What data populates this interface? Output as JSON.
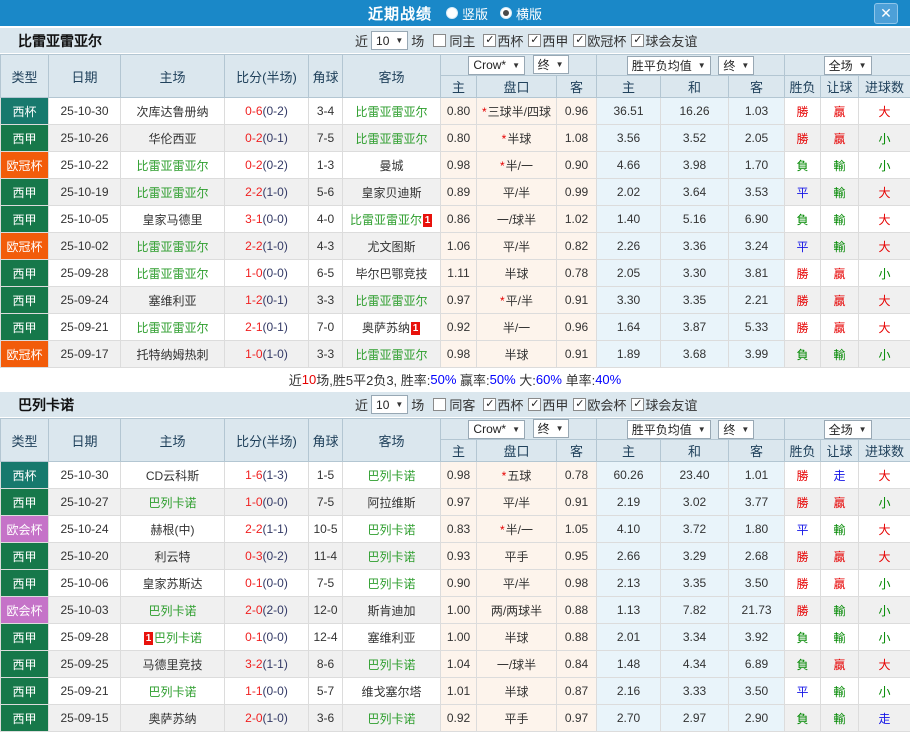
{
  "titlebar": {
    "title": "近期战绩",
    "radio_vertical": "竖版",
    "radio_horizontal": "横版"
  },
  "ui": {
    "check": "✓",
    "arrow": "▼",
    "close": "✕"
  },
  "colors": {
    "topbar": "#1a88c8",
    "header_bg": "#dbe7ee",
    "team_highlight": "#2e9e2e",
    "score_red": "#f02020",
    "type_badge": {
      "西杯": "#17796d",
      "西甲": "#16784a",
      "欧冠杯": "#f25c0a",
      "欧会杯": "#c573c8"
    },
    "result": {
      "勝": "#e60000",
      "贏": "#e60000",
      "大": "#e60000",
      "負": "#008800",
      "輸": "#008800",
      "小": "#008800",
      "平": "#1414e6",
      "走": "#1414e6"
    }
  },
  "table_columns": {
    "type": "类型",
    "date": "日期",
    "home": "主场",
    "score": "比分(半场)",
    "corner": "角球",
    "away": "客场",
    "odds_home": "主",
    "odds_handicap": "盘口",
    "odds_away": "客",
    "avg_home": "主",
    "avg_draw": "和",
    "avg_away": "客",
    "result_wdl": "胜负",
    "result_handicap": "让球",
    "result_goals": "进球数",
    "odds_select": "Crow*",
    "odds_final_select": "终",
    "avg_select": "胜平负均值",
    "avg_final_select": "终",
    "scope_select": "全场"
  },
  "sections": [
    {
      "team": "比雷亚雷亚尔",
      "filter": {
        "near": "近",
        "games": "10",
        "unit": "场",
        "same": "同主",
        "same_checked": false,
        "leagues": [
          {
            "label": "西杯",
            "checked": true
          },
          {
            "label": "西甲",
            "checked": true
          },
          {
            "label": "欧冠杯",
            "checked": true
          },
          {
            "label": "球会友谊",
            "checked": true
          }
        ]
      },
      "rows": [
        {
          "type": "西杯",
          "date": "25-10-30",
          "home": {
            "name": "次库达鲁册纳",
            "green": false
          },
          "score": "0-6",
          "half": "(0-2)",
          "corner": "3-4",
          "away": {
            "name": "比雷亚雷亚尔",
            "green": true
          },
          "odds_home": "0.80",
          "handicap_star": true,
          "handicap": "三球半/四球",
          "odds_away": "0.96",
          "avg_home": "36.51",
          "avg_draw": "16.26",
          "avg_away": "1.03",
          "res_wdl": "勝",
          "res_handicap": "贏",
          "res_goals": "大"
        },
        {
          "type": "西甲",
          "date": "25-10-26",
          "home": {
            "name": "华伦西亚",
            "green": false
          },
          "score": "0-2",
          "half": "(0-1)",
          "corner": "7-5",
          "away": {
            "name": "比雷亚雷亚尔",
            "green": true
          },
          "odds_home": "0.80",
          "handicap_star": true,
          "handicap": "半球",
          "odds_away": "1.08",
          "avg_home": "3.56",
          "avg_draw": "3.52",
          "avg_away": "2.05",
          "res_wdl": "勝",
          "res_handicap": "贏",
          "res_goals": "小"
        },
        {
          "type": "欧冠杯",
          "date": "25-10-22",
          "home": {
            "name": "比雷亚雷亚尔",
            "green": true
          },
          "score": "0-2",
          "half": "(0-2)",
          "corner": "1-3",
          "away": {
            "name": "曼城",
            "green": false
          },
          "odds_home": "0.98",
          "handicap_star": true,
          "handicap": "半/一",
          "odds_away": "0.90",
          "avg_home": "4.66",
          "avg_draw": "3.98",
          "avg_away": "1.70",
          "res_wdl": "負",
          "res_handicap": "輸",
          "res_goals": "小"
        },
        {
          "type": "西甲",
          "date": "25-10-19",
          "home": {
            "name": "比雷亚雷亚尔",
            "green": true
          },
          "score": "2-2",
          "half": "(1-0)",
          "corner": "5-6",
          "away": {
            "name": "皇家贝迪斯",
            "green": false
          },
          "odds_home": "0.89",
          "handicap_star": false,
          "handicap": "平/半",
          "odds_away": "0.99",
          "avg_home": "2.02",
          "avg_draw": "3.64",
          "avg_away": "3.53",
          "res_wdl": "平",
          "res_handicap": "輸",
          "res_goals": "大"
        },
        {
          "type": "西甲",
          "date": "25-10-05",
          "home": {
            "name": "皇家马德里",
            "green": false
          },
          "score": "3-1",
          "half": "(0-0)",
          "corner": "4-0",
          "away": {
            "name": "比雷亚雷亚尔",
            "green": true,
            "badge": "1",
            "badge_pos": "after"
          },
          "odds_home": "0.86",
          "handicap_star": false,
          "handicap": "一/球半",
          "odds_away": "1.02",
          "avg_home": "1.40",
          "avg_draw": "5.16",
          "avg_away": "6.90",
          "res_wdl": "負",
          "res_handicap": "輸",
          "res_goals": "大"
        },
        {
          "type": "欧冠杯",
          "date": "25-10-02",
          "home": {
            "name": "比雷亚雷亚尔",
            "green": true
          },
          "score": "2-2",
          "half": "(1-0)",
          "corner": "4-3",
          "away": {
            "name": "尤文图斯",
            "green": false
          },
          "odds_home": "1.06",
          "handicap_star": false,
          "handicap": "平/半",
          "odds_away": "0.82",
          "avg_home": "2.26",
          "avg_draw": "3.36",
          "avg_away": "3.24",
          "res_wdl": "平",
          "res_handicap": "輸",
          "res_goals": "大"
        },
        {
          "type": "西甲",
          "date": "25-09-28",
          "home": {
            "name": "比雷亚雷亚尔",
            "green": true
          },
          "score": "1-0",
          "half": "(0-0)",
          "corner": "6-5",
          "away": {
            "name": "毕尔巴鄂竞技",
            "green": false
          },
          "odds_home": "1.11",
          "handicap_star": false,
          "handicap": "半球",
          "odds_away": "0.78",
          "avg_home": "2.05",
          "avg_draw": "3.30",
          "avg_away": "3.81",
          "res_wdl": "勝",
          "res_handicap": "贏",
          "res_goals": "小"
        },
        {
          "type": "西甲",
          "date": "25-09-24",
          "home": {
            "name": "塞维利亚",
            "green": false
          },
          "score": "1-2",
          "half": "(0-1)",
          "corner": "3-3",
          "away": {
            "name": "比雷亚雷亚尔",
            "green": true
          },
          "odds_home": "0.97",
          "handicap_star": true,
          "handicap": "平/半",
          "odds_away": "0.91",
          "avg_home": "3.30",
          "avg_draw": "3.35",
          "avg_away": "2.21",
          "res_wdl": "勝",
          "res_handicap": "贏",
          "res_goals": "大"
        },
        {
          "type": "西甲",
          "date": "25-09-21",
          "home": {
            "name": "比雷亚雷亚尔",
            "green": true
          },
          "score": "2-1",
          "half": "(0-1)",
          "corner": "7-0",
          "away": {
            "name": "奥萨苏纳",
            "green": false,
            "badge": "1",
            "badge_pos": "after"
          },
          "odds_home": "0.92",
          "handicap_star": false,
          "handicap": "半/一",
          "odds_away": "0.96",
          "avg_home": "1.64",
          "avg_draw": "3.87",
          "avg_away": "5.33",
          "res_wdl": "勝",
          "res_handicap": "贏",
          "res_goals": "大"
        },
        {
          "type": "欧冠杯",
          "date": "25-09-17",
          "home": {
            "name": "托特纳姆热刺",
            "green": false
          },
          "score": "1-0",
          "half": "(1-0)",
          "corner": "3-3",
          "away": {
            "name": "比雷亚雷亚尔",
            "green": true
          },
          "odds_home": "0.98",
          "handicap_star": false,
          "handicap": "半球",
          "odds_away": "0.91",
          "avg_home": "1.89",
          "avg_draw": "3.68",
          "avg_away": "3.99",
          "res_wdl": "負",
          "res_handicap": "輸",
          "res_goals": "小"
        }
      ],
      "summary": [
        {
          "text": "近",
          "color": "#333333"
        },
        {
          "text": "10",
          "color": "#e60000"
        },
        {
          "text": "场,胜5平2负3, 胜率:",
          "color": "#333333"
        },
        {
          "text": "50%",
          "color": "#0000ff"
        },
        {
          "text": " 赢率:",
          "color": "#333333"
        },
        {
          "text": "50%",
          "color": "#0000ff"
        },
        {
          "text": " 大:",
          "color": "#333333"
        },
        {
          "text": "60%",
          "color": "#0000ff"
        },
        {
          "text": " 单率:",
          "color": "#333333"
        },
        {
          "text": "40%",
          "color": "#0000ff"
        }
      ]
    },
    {
      "team": "巴列卡诺",
      "filter": {
        "near": "近",
        "games": "10",
        "unit": "场",
        "same": "同客",
        "same_checked": false,
        "leagues": [
          {
            "label": "西杯",
            "checked": true
          },
          {
            "label": "西甲",
            "checked": true
          },
          {
            "label": "欧会杯",
            "checked": true
          },
          {
            "label": "球会友谊",
            "checked": true
          }
        ]
      },
      "rows": [
        {
          "type": "西杯",
          "date": "25-10-30",
          "home": {
            "name": "CD云科斯",
            "green": false
          },
          "score": "1-6",
          "half": "(1-3)",
          "corner": "1-5",
          "away": {
            "name": "巴列卡诺",
            "green": true
          },
          "odds_home": "0.98",
          "handicap_star": true,
          "handicap": "五球",
          "odds_away": "0.78",
          "avg_home": "60.26",
          "avg_draw": "23.40",
          "avg_away": "1.01",
          "res_wdl": "勝",
          "res_handicap": "走",
          "res_goals": "大"
        },
        {
          "type": "西甲",
          "date": "25-10-27",
          "home": {
            "name": "巴列卡诺",
            "green": true
          },
          "score": "1-0",
          "half": "(0-0)",
          "corner": "7-5",
          "away": {
            "name": "阿拉维斯",
            "green": false
          },
          "odds_home": "0.97",
          "handicap_star": false,
          "handicap": "平/半",
          "odds_away": "0.91",
          "avg_home": "2.19",
          "avg_draw": "3.02",
          "avg_away": "3.77",
          "res_wdl": "勝",
          "res_handicap": "贏",
          "res_goals": "小"
        },
        {
          "type": "欧会杯",
          "date": "25-10-24",
          "home": {
            "name": "赫根(中)",
            "green": false
          },
          "score": "2-2",
          "half": "(1-1)",
          "corner": "10-5",
          "away": {
            "name": "巴列卡诺",
            "green": true
          },
          "odds_home": "0.83",
          "handicap_star": true,
          "handicap": "半/一",
          "odds_away": "1.05",
          "avg_home": "4.10",
          "avg_draw": "3.72",
          "avg_away": "1.80",
          "res_wdl": "平",
          "res_handicap": "輸",
          "res_goals": "大"
        },
        {
          "type": "西甲",
          "date": "25-10-20",
          "home": {
            "name": "利云特",
            "green": false
          },
          "score": "0-3",
          "half": "(0-2)",
          "corner": "11-4",
          "away": {
            "name": "巴列卡诺",
            "green": true
          },
          "odds_home": "0.93",
          "handicap_star": false,
          "handicap": "平手",
          "odds_away": "0.95",
          "avg_home": "2.66",
          "avg_draw": "3.29",
          "avg_away": "2.68",
          "res_wdl": "勝",
          "res_handicap": "贏",
          "res_goals": "大"
        },
        {
          "type": "西甲",
          "date": "25-10-06",
          "home": {
            "name": "皇家苏斯达",
            "green": false
          },
          "score": "0-1",
          "half": "(0-0)",
          "corner": "7-5",
          "away": {
            "name": "巴列卡诺",
            "green": true
          },
          "odds_home": "0.90",
          "handicap_star": false,
          "handicap": "平/半",
          "odds_away": "0.98",
          "avg_home": "2.13",
          "avg_draw": "3.35",
          "avg_away": "3.50",
          "res_wdl": "勝",
          "res_handicap": "贏",
          "res_goals": "小"
        },
        {
          "type": "欧会杯",
          "date": "25-10-03",
          "home": {
            "name": "巴列卡诺",
            "green": true
          },
          "score": "2-0",
          "half": "(2-0)",
          "corner": "12-0",
          "away": {
            "name": "斯肯迪加",
            "green": false
          },
          "odds_home": "1.00",
          "handicap_star": false,
          "handicap": "两/两球半",
          "odds_away": "0.88",
          "avg_home": "1.13",
          "avg_draw": "7.82",
          "avg_away": "21.73",
          "res_wdl": "勝",
          "res_handicap": "輸",
          "res_goals": "小"
        },
        {
          "type": "西甲",
          "date": "25-09-28",
          "home": {
            "name": "巴列卡诺",
            "green": true,
            "badge": "1",
            "badge_pos": "before"
          },
          "score": "0-1",
          "half": "(0-0)",
          "corner": "12-4",
          "away": {
            "name": "塞维利亚",
            "green": false
          },
          "odds_home": "1.00",
          "handicap_star": false,
          "handicap": "半球",
          "odds_away": "0.88",
          "avg_home": "2.01",
          "avg_draw": "3.34",
          "avg_away": "3.92",
          "res_wdl": "負",
          "res_handicap": "輸",
          "res_goals": "小"
        },
        {
          "type": "西甲",
          "date": "25-09-25",
          "home": {
            "name": "马德里竞技",
            "green": false
          },
          "score": "3-2",
          "half": "(1-1)",
          "corner": "8-6",
          "away": {
            "name": "巴列卡诺",
            "green": true
          },
          "odds_home": "1.04",
          "handicap_star": false,
          "handicap": "一/球半",
          "odds_away": "0.84",
          "avg_home": "1.48",
          "avg_draw": "4.34",
          "avg_away": "6.89",
          "res_wdl": "負",
          "res_handicap": "贏",
          "res_goals": "大"
        },
        {
          "type": "西甲",
          "date": "25-09-21",
          "home": {
            "name": "巴列卡诺",
            "green": true
          },
          "score": "1-1",
          "half": "(0-0)",
          "corner": "5-7",
          "away": {
            "name": "维戈塞尔塔",
            "green": false
          },
          "odds_home": "1.01",
          "handicap_star": false,
          "handicap": "半球",
          "odds_away": "0.87",
          "avg_home": "2.16",
          "avg_draw": "3.33",
          "avg_away": "3.50",
          "res_wdl": "平",
          "res_handicap": "輸",
          "res_goals": "小"
        },
        {
          "type": "西甲",
          "date": "25-09-15",
          "home": {
            "name": "奥萨苏纳",
            "green": false
          },
          "score": "2-0",
          "half": "(1-0)",
          "corner": "3-6",
          "away": {
            "name": "巴列卡诺",
            "green": true
          },
          "odds_home": "0.92",
          "handicap_star": false,
          "handicap": "平手",
          "odds_away": "0.97",
          "avg_home": "2.70",
          "avg_draw": "2.97",
          "avg_away": "2.90",
          "res_wdl": "負",
          "res_handicap": "輸",
          "res_goals": "走"
        }
      ],
      "summary": []
    }
  ]
}
